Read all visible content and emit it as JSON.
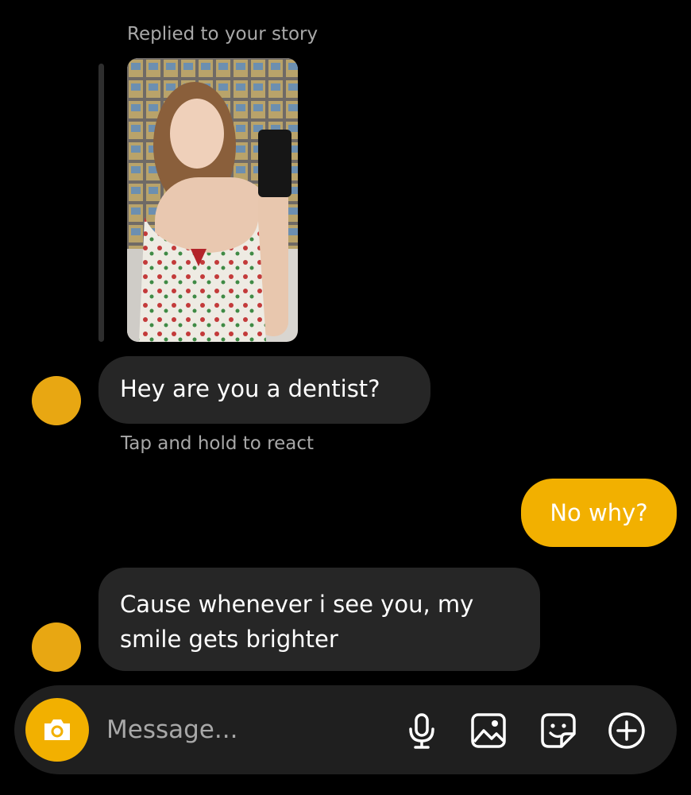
{
  "thread": {
    "story_reply_label": "Replied to your story",
    "react_hint": "Tap and hold to react",
    "messages": [
      {
        "sender": "them",
        "text": "Hey are you a dentist?"
      },
      {
        "sender": "me",
        "text": "No why?"
      },
      {
        "sender": "them",
        "line1": "Cause whenever i see you, my",
        "line2": "smile gets brighter"
      }
    ]
  },
  "composer": {
    "placeholder": "Message...",
    "icons": [
      "camera-icon",
      "microphone-icon",
      "gallery-icon",
      "sticker-icon",
      "plus-circle-icon"
    ]
  },
  "colors": {
    "background": "#000000",
    "incoming_bubble": "#262626",
    "outgoing_bubble": "#f2b000",
    "avatar": "#e8a712",
    "muted_text": "#a8a8a8"
  }
}
